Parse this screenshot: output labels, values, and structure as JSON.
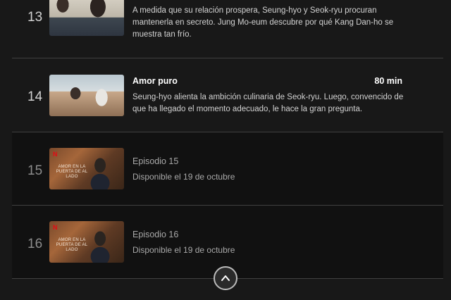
{
  "episodes": [
    {
      "number": "13",
      "title": "",
      "duration": "",
      "description": "A medida que su relación prospera, Seung-hyo y Seok-ryu procuran mantenerla en secreto. Jung Mo-eum descubre por qué Kang Dan-ho se muestra tan frío."
    },
    {
      "number": "14",
      "title": "Amor puro",
      "duration": "80 min",
      "description": "Seung-hyo alienta la ambición culinaria de Seok-ryu. Luego, convencido de que ha llegado el momento adecuado, le hace la gran pregunta."
    },
    {
      "number": "15",
      "title": "Episodio 15",
      "availability": "Disponible el 19 de octubre",
      "thumb_brand": "N",
      "thumb_title_art": "AMOR EN LA PUERTA DE AL LADO"
    },
    {
      "number": "16",
      "title": "Episodio 16",
      "availability": "Disponible el 19 de octubre",
      "thumb_brand": "N",
      "thumb_title_art": "AMOR EN LA PUERTA DE AL LADO"
    }
  ],
  "collapse_button": {
    "icon": "chevron-up-icon"
  },
  "colors": {
    "background": "#181818",
    "unavailable_row_bg": "#111111",
    "divider": "#404040",
    "netflix_red": "#e50914"
  }
}
